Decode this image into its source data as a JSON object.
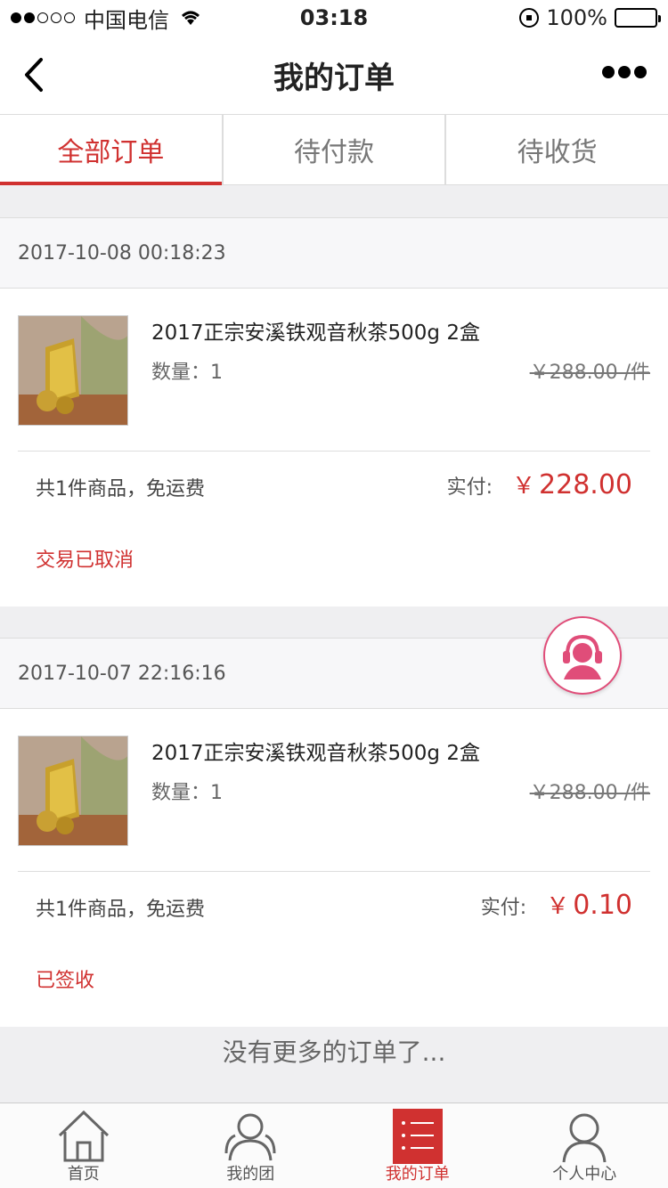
{
  "status_bar": {
    "carrier": "中国电信",
    "time": "03:18",
    "battery": "100%"
  },
  "nav": {
    "title": "我的订单"
  },
  "tabs": [
    {
      "label": "全部订单",
      "active": true
    },
    {
      "label": "待付款",
      "active": false
    },
    {
      "label": "待收货",
      "active": false
    }
  ],
  "orders": [
    {
      "date": "2017-10-08 00:18:23",
      "item_name": "2017正宗安溪铁观音秋茶500g 2盒",
      "qty": "数量：1",
      "unit_price": "￥288.00 /件",
      "summary": "共1件商品，免运费",
      "paid_label": "实付:",
      "paid_currency": "￥",
      "paid_amount": "228.00",
      "status": "交易已取消"
    },
    {
      "date": "2017-10-07 22:16:16",
      "item_name": "2017正宗安溪铁观音秋茶500g 2盒",
      "qty": "数量：1",
      "unit_price": "￥288.00 /件",
      "summary": "共1件商品，免运费",
      "paid_label": "实付:",
      "paid_currency": "￥",
      "paid_amount": "0.10",
      "status": "已签收"
    }
  ],
  "no_more": "没有更多的订单了...",
  "bottom_nav": [
    {
      "label": "首页",
      "icon": "home-icon"
    },
    {
      "label": "我的团",
      "icon": "group-icon"
    },
    {
      "label": "我的订单",
      "icon": "order-list-icon",
      "active": true
    },
    {
      "label": "个人中心",
      "icon": "person-icon"
    }
  ],
  "colors": {
    "accent": "#d03130",
    "cs_pink": "#e04d79"
  }
}
